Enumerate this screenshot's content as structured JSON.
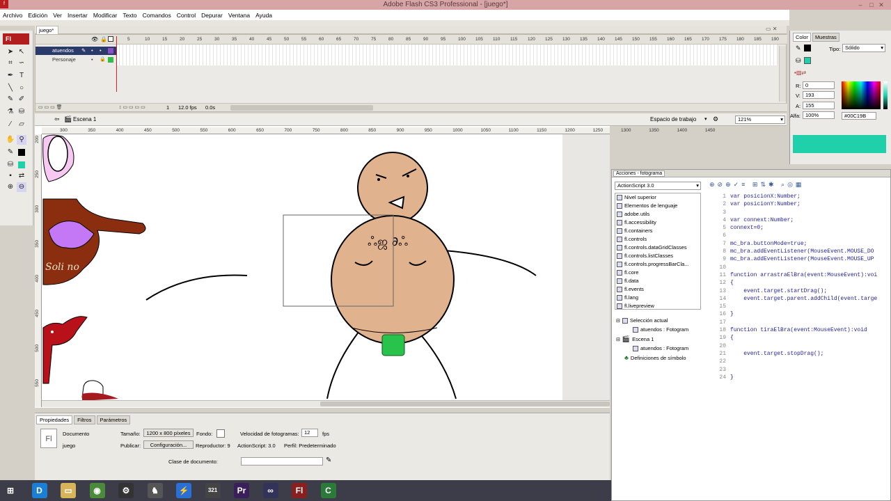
{
  "window": {
    "title": "Adobe Flash CS3 Professional - [juego*]",
    "min": "–",
    "max": "□",
    "close": "✕"
  },
  "menu": [
    "Archivo",
    "Edición",
    "Ver",
    "Insertar",
    "Modificar",
    "Texto",
    "Comandos",
    "Control",
    "Depurar",
    "Ventana",
    "Ayuda"
  ],
  "toolbox": {
    "logo": "Fl"
  },
  "doc_tab": "juego*",
  "timeline": {
    "layers": [
      {
        "name": "atuendos",
        "color": "#8a4fc4"
      },
      {
        "name": "Personaje",
        "color": "#2fbf47"
      }
    ],
    "frame_ticks": [
      "5",
      "10",
      "15",
      "20",
      "25",
      "30",
      "35",
      "40",
      "45",
      "50",
      "55",
      "60",
      "65",
      "70",
      "75",
      "80",
      "85",
      "90",
      "95",
      "100",
      "105",
      "110",
      "115",
      "120",
      "125",
      "130",
      "135",
      "140",
      "145",
      "150",
      "155",
      "160",
      "165",
      "170",
      "175",
      "180",
      "185",
      "190"
    ],
    "status": {
      "frame": "1",
      "fps": "12.0 fps",
      "time": "0.0s"
    }
  },
  "scene": {
    "name": "Escena 1",
    "workspace": "Espacio de trabajo",
    "zoom": "121%"
  },
  "ruler_h": [
    "300",
    "350",
    "400",
    "450",
    "500",
    "550",
    "600",
    "650",
    "700",
    "750",
    "800",
    "850",
    "900",
    "950",
    "1000",
    "1050",
    "1100",
    "1150",
    "1200",
    "1250",
    "1300",
    "1350",
    "1400",
    "1450"
  ],
  "ruler_v": [
    "200",
    "250",
    "300",
    "350",
    "400",
    "450",
    "500",
    "550",
    "600"
  ],
  "stage": {
    "logo_text": "Soli no"
  },
  "properties": {
    "tabs": [
      "Propiedades",
      "Filtros",
      "Parámetros"
    ],
    "doc_label": "Documento",
    "doc_name": "juego",
    "icon": "Fl",
    "size_label": "Tamaño:",
    "size_value": "1200 x 800 píxeles",
    "bg_label": "Fondo:",
    "fps_label": "Velocidad de fotogramas:",
    "fps_value": "12",
    "fps_unit": "fps",
    "publish_label": "Publicar:",
    "publish_button": "Configuración...",
    "player": "Reproductor: 9",
    "actionscript": "ActionScript: 3.0",
    "profile": "Perfil: Predeterminado",
    "class_label": "Clase de documento:"
  },
  "color_panel": {
    "tabs": [
      "Color",
      "Muestras"
    ],
    "type_label": "Tipo:",
    "type_value": "Sólido",
    "r_label": "R:",
    "r_value": "0",
    "g_label": "V:",
    "g_value": "193",
    "b_label": "A:",
    "b_value": "155",
    "alpha_label": "Alfa:",
    "alpha_value": "100%",
    "hex": "#00C19B",
    "swatch_color": "#1fd0ab"
  },
  "actions": {
    "title": "Acciones - fotograma",
    "language": "ActionScript 3.0",
    "toolbox_items": [
      "Nivel superior",
      "Elementos de lenguaje",
      "adobe.utils",
      "fl.accessibility",
      "fl.containers",
      "fl.controls",
      "fl.controls.dataGridClasses",
      "fl.controls.listClasses",
      "fl.controls.progressBarCla...",
      "fl.core",
      "fl.data",
      "fl.events",
      "fl.lang",
      "fl.livepreview"
    ],
    "script_nav": [
      "Selección actual",
      "atuendos : Fotogram",
      "Escena 1",
      "atuendos : Fotogram",
      "Definiciones de símbolo"
    ],
    "line_numbers": [
      "1",
      "2",
      "3",
      "4",
      "5",
      "6",
      "7",
      "8",
      "9",
      "10",
      "11",
      "12",
      "13",
      "14",
      "15",
      "16",
      "17",
      "18",
      "19",
      "20",
      "21",
      "22",
      "23",
      "24"
    ],
    "code": [
      "var posicionX:Number;",
      "var posicionY:Number;",
      "",
      "var connext:Number;",
      "connext=0;",
      "",
      "mc_bra.buttonMode=true;",
      "mc_bra.addEventListener(MouseEvent.MOUSE_DO",
      "mc_bra.addEventListener(MouseEvent.MOUSE_UP",
      "",
      "function arrastraElBra(event:MouseEvent):voi",
      "{",
      "    event.target.startDrag();",
      "    event.target.parent.addChild(event.targe",
      "",
      "}",
      "",
      "function tiraElBra(event:MouseEvent):void",
      "{",
      "",
      "    event.target.stopDrag();",
      "",
      "",
      "}"
    ]
  },
  "taskbar": {
    "apps": [
      {
        "name": "start",
        "glyph": "⊞",
        "color": "#3d3d4a"
      },
      {
        "name": "daemon",
        "glyph": "D",
        "color": "#1b7fd6"
      },
      {
        "name": "explorer",
        "glyph": "▭",
        "color": "#d7b35a"
      },
      {
        "name": "chrome",
        "glyph": "◉",
        "color": "#4a8a3a"
      },
      {
        "name": "steam",
        "glyph": "⚙",
        "color": "#333"
      },
      {
        "name": "app",
        "glyph": "♞",
        "color": "#555"
      },
      {
        "name": "bolt",
        "glyph": "⚡",
        "color": "#2a6fd6"
      },
      {
        "name": "calendar",
        "glyph": "321",
        "color": "#444"
      },
      {
        "name": "premiere",
        "glyph": "Pr",
        "color": "#3a1f5a"
      },
      {
        "name": "link",
        "glyph": "∞",
        "color": "#33335a"
      },
      {
        "name": "flash",
        "glyph": "Fl",
        "color": "#8a1f1f"
      },
      {
        "name": "camtasia",
        "glyph": "C",
        "color": "#2c7a3a"
      }
    ]
  }
}
